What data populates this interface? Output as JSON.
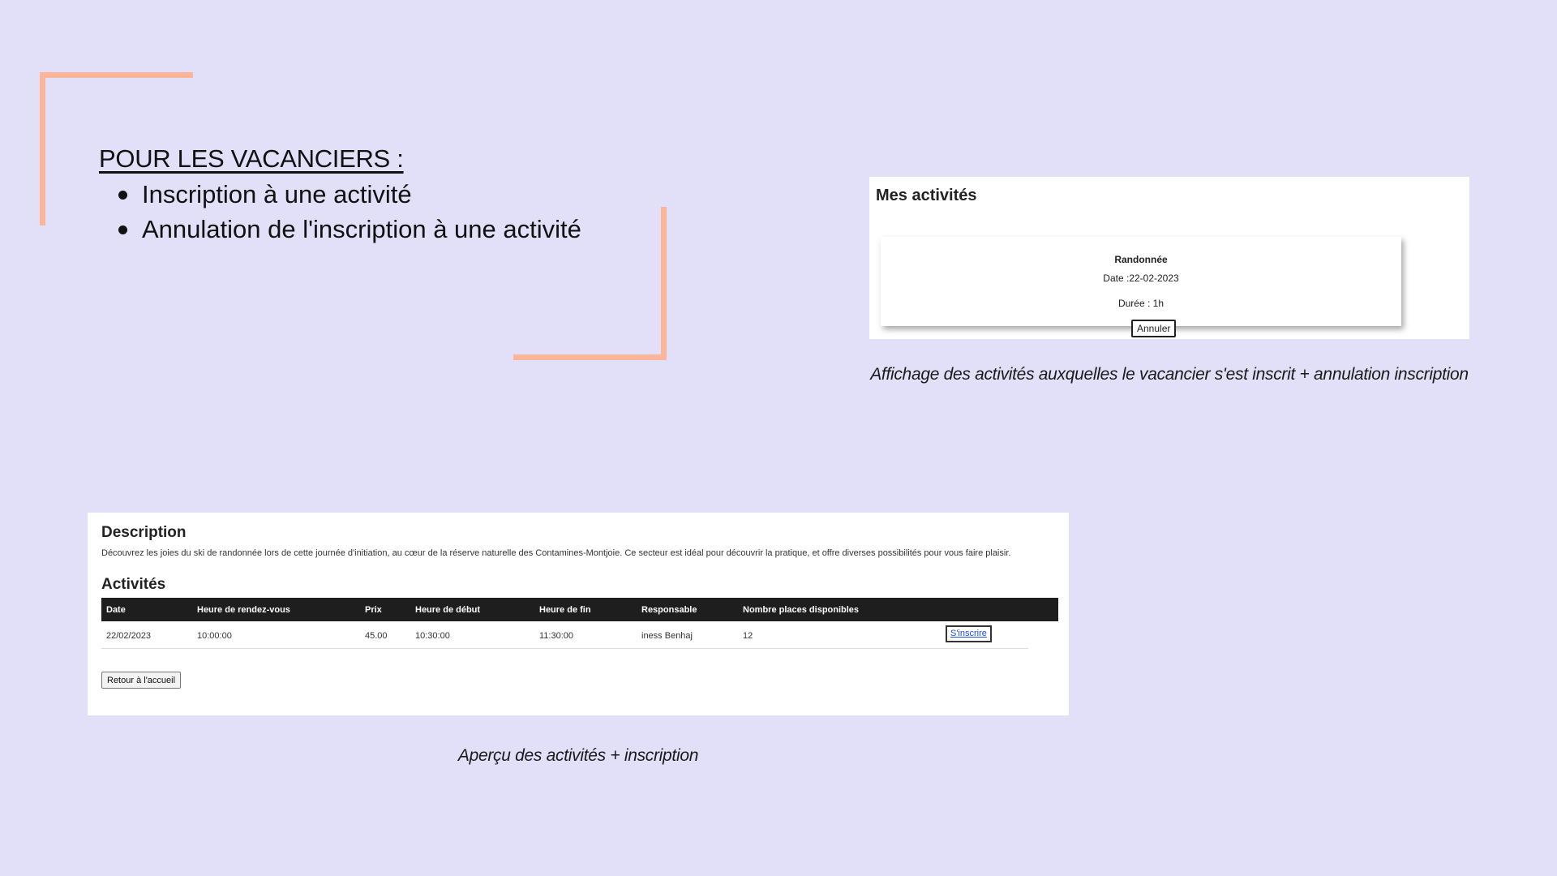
{
  "slide": {
    "title": "POUR LES VACANCIERS :",
    "bullets": [
      "Inscription à une activité",
      "Annulation de l'inscription à une activité"
    ],
    "accent_color": "#fdb59a",
    "background_color": "#e1e0f8"
  },
  "mes_activites": {
    "heading": "Mes activités",
    "card": {
      "name": "Randonnée",
      "date": "Date :22-02-2023",
      "duration": "Durée : 1h",
      "cancel_label": "Annuler"
    },
    "caption": "Affichage des activités auxquelles le vacancier s'est inscrit + annulation inscription"
  },
  "apercu": {
    "description_heading": "Description",
    "description_text": "Découvrez les joies du ski de randonnée lors de cette journée d'initiation, au cœur de la réserve naturelle des Contamines-Montjoie. Ce secteur est idéal pour découvrir la pratique, et offre diverses possibilités pour vous faire plaisir.",
    "activities_heading": "Activités",
    "columns": [
      "Date",
      "Heure de rendez-vous",
      "Prix",
      "Heure de début",
      "Heure de fin",
      "Responsable",
      "Nombre places disponibles"
    ],
    "rows": [
      {
        "date": "22/02/2023",
        "heure_rdv": "10:00:00",
        "prix": "45.00",
        "heure_debut": "10:30:00",
        "heure_fin": "11:30:00",
        "responsable": "iness Benhaj",
        "places": "12",
        "action_label": "S'inscrire"
      }
    ],
    "home_button_label": "Retour à l'accueil",
    "caption": "Aperçu des activités + inscription"
  }
}
